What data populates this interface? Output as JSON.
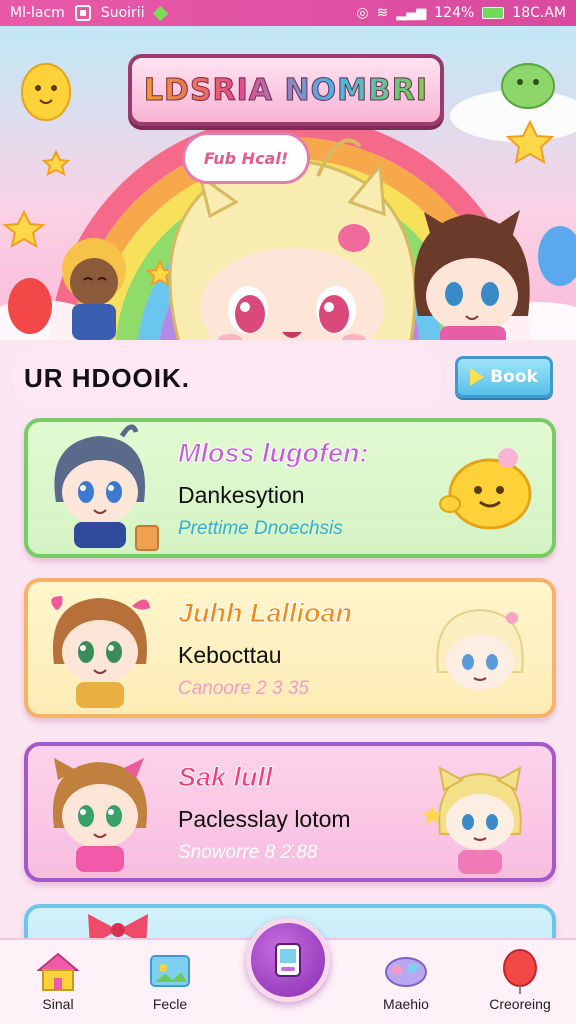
{
  "status_bar": {
    "carrier": "Ml-lacm",
    "app_name": "Suoirii",
    "battery": "124%",
    "time": "18C.AM"
  },
  "hero": {
    "title": "LDSRIA NOMBRI",
    "speech": "Fub Hcal!"
  },
  "section": {
    "title": "UR HDOOIK.",
    "book_button": "Book"
  },
  "cards": [
    {
      "title": "Mloss lugofen:",
      "subtitle": "Dankesytion",
      "meta": "Prettime Dnoechsis"
    },
    {
      "title": "Juhh Lallioan",
      "subtitle": "Kebocttau",
      "meta": "Canoore 2 3 35"
    },
    {
      "title": "Sak lull",
      "subtitle": "Paclesslay lotom",
      "meta": "Snoworre 8 2̈.88"
    }
  ],
  "nav": {
    "home": "Sinal",
    "feed": "Fecle",
    "messages": "Maehio",
    "creating": "Creoreing"
  },
  "colors": {
    "status_bar": "#e85aa8",
    "card_green_border": "#78cc66",
    "card_yellow_border": "#f7b26a",
    "card_pink_border": "#a259c9",
    "accent_purple": "#8a2cb0"
  }
}
